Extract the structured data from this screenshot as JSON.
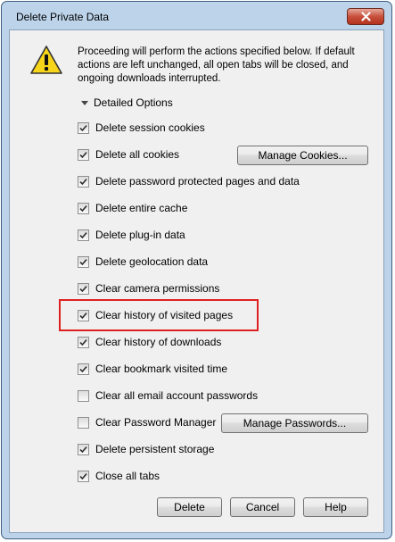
{
  "window": {
    "title": "Delete Private Data"
  },
  "intro_text": "Proceeding will perform the actions specified below. If default actions are left unchanged, all open tabs will be closed, and ongoing downloads interrupted.",
  "details_label": "Detailed Options",
  "options": [
    {
      "label": "Delete session cookies",
      "checked": true
    },
    {
      "label": "Delete all cookies",
      "checked": true
    },
    {
      "label": "Delete password protected pages and data",
      "checked": true
    },
    {
      "label": "Delete entire cache",
      "checked": true
    },
    {
      "label": "Delete plug-in data",
      "checked": true
    },
    {
      "label": "Delete geolocation data",
      "checked": true
    },
    {
      "label": "Clear camera permissions",
      "checked": true
    },
    {
      "label": "Clear history of visited pages",
      "checked": true
    },
    {
      "label": "Clear history of downloads",
      "checked": true
    },
    {
      "label": "Clear bookmark visited time",
      "checked": true
    },
    {
      "label": "Clear all email account passwords",
      "checked": false
    },
    {
      "label": "Clear Password Manager",
      "checked": false
    },
    {
      "label": "Delete persistent storage",
      "checked": true
    },
    {
      "label": "Close all tabs",
      "checked": true
    }
  ],
  "buttons": {
    "manage_cookies": "Manage Cookies...",
    "manage_passwords": "Manage Passwords...",
    "delete": "Delete",
    "cancel": "Cancel",
    "help": "Help"
  },
  "icons": {
    "warning": "warning-icon",
    "close": "close-icon"
  }
}
